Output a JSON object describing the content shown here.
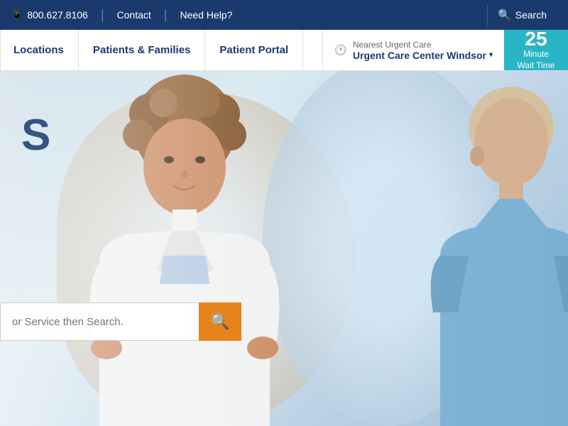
{
  "topbar": {
    "phone": "800.627.8106",
    "contact": "Contact",
    "needhelp": "Need Help?",
    "search": "Search"
  },
  "nav": {
    "items": [
      {
        "label": "Locations"
      },
      {
        "label": "Patients & Families"
      },
      {
        "label": "Patient Portal"
      }
    ]
  },
  "urgentcare": {
    "label": "Nearest Urgent Care",
    "location": "Urgent Care Center Windsor",
    "wait_number": "25",
    "wait_line1": "Minute",
    "wait_line2": "Wait Time"
  },
  "hero": {
    "heading_partial": "S",
    "search_placeholder": "or Service then Search.",
    "search_button_icon": "🔍"
  },
  "icons": {
    "phone": "📱",
    "location": "🕐",
    "search": "🔍",
    "chevron": "▾"
  }
}
